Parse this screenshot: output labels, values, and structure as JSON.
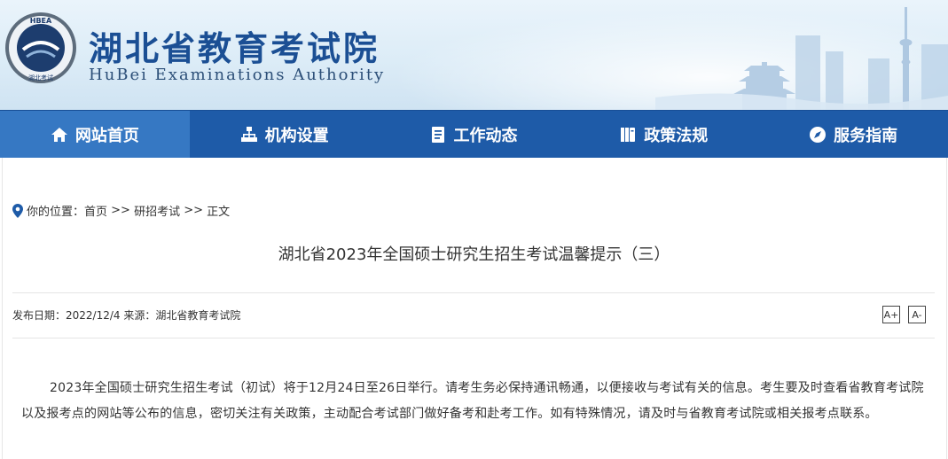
{
  "header": {
    "logo_text": "HBEA 湖北考试",
    "title_cn": "湖北省教育考试院",
    "title_en": "HuBei Examinations Authority"
  },
  "nav": {
    "items": [
      {
        "label": "网站首页",
        "icon": "home-icon"
      },
      {
        "label": "机构设置",
        "icon": "org-chart-icon"
      },
      {
        "label": "工作动态",
        "icon": "document-icon"
      },
      {
        "label": "政策法规",
        "icon": "book-icon"
      },
      {
        "label": "服务指南",
        "icon": "compass-icon"
      }
    ]
  },
  "breadcrumb": {
    "icon": "location-pin-icon",
    "prefix": "你的位置：",
    "home": "首页",
    "sep1": " >> ",
    "section": "研招考试",
    "sep2": " >> ",
    "current": "正文"
  },
  "article": {
    "title": "湖北省2023年全国硕士研究生招生考试温馨提示（三）",
    "meta": "发布日期：2022/12/4 来源：湖北省教育考试院",
    "font_increase": "A+",
    "font_decrease": "A-",
    "body": "2023年全国硕士研究生招生考试（初试）将于12月24日至26日举行。请考生务必保持通讯畅通，以便接收与考试有关的信息。考生要及时查看省教育考试院以及报考点的网站等公布的信息，密切关注有关政策，主动配合考试部门做好备考和赴考工作。如有特殊情况，请及时与省教育考试院或相关报考点联系。"
  },
  "colors": {
    "nav_bg": "#1e5ba8",
    "nav_active": "#3678c3",
    "title_blue": "#1b4f94"
  }
}
